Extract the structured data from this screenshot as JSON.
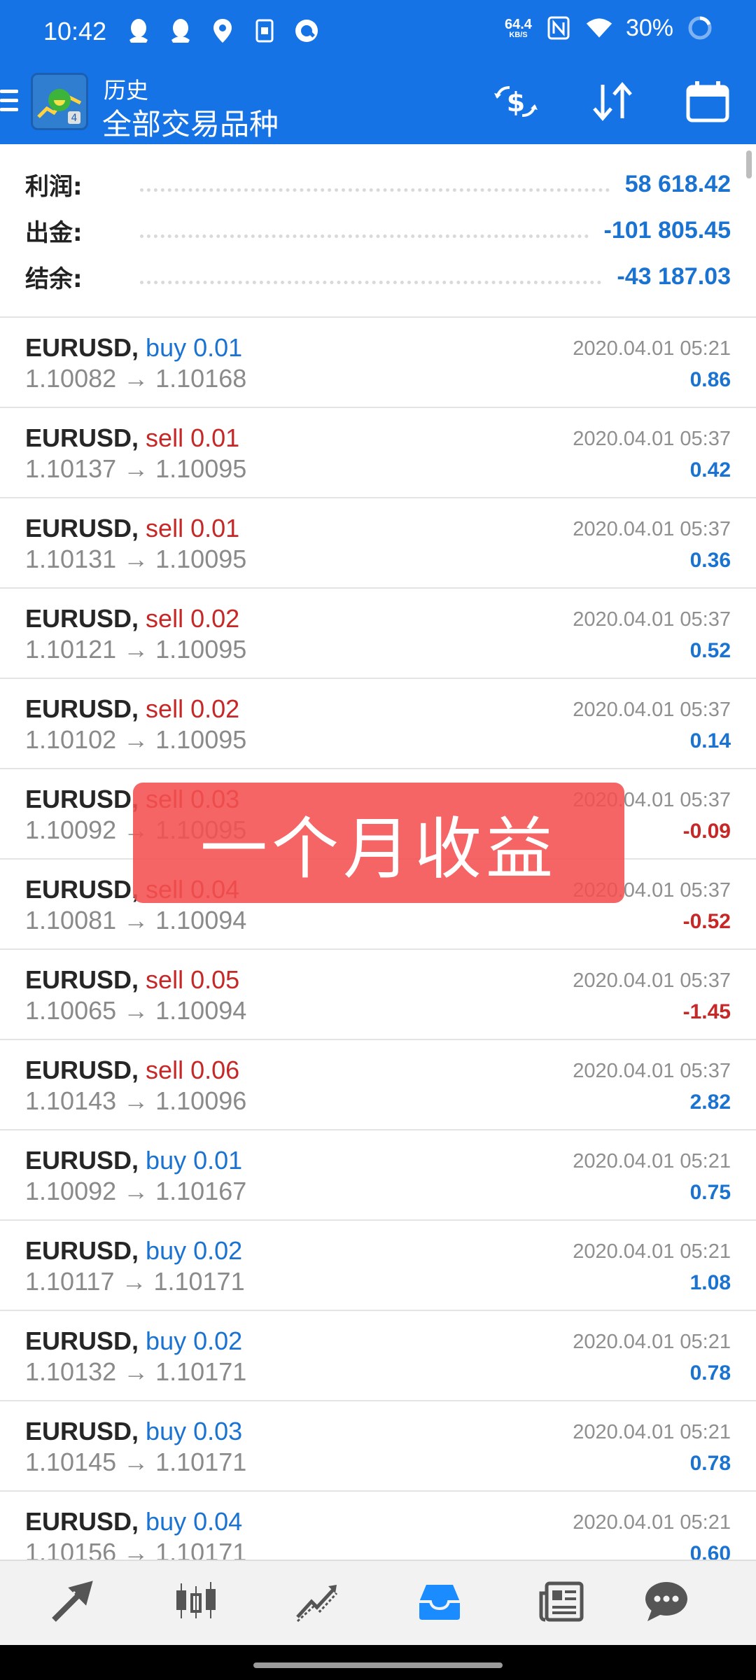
{
  "status_bar": {
    "time": "10:42",
    "speed_value": "64.4",
    "speed_unit": "KB/S",
    "battery": "30%",
    "icons": [
      "qq-icon",
      "qq-icon",
      "location-icon",
      "sim-icon",
      "app-icon",
      "nfc-icon",
      "wifi-icon",
      "battery-ring-icon"
    ]
  },
  "header": {
    "subtitle": "历史",
    "title": "全部交易品种",
    "buttons": [
      "currency-exchange-icon",
      "sort-icon",
      "calendar-icon"
    ]
  },
  "summary": [
    {
      "label": "利润:",
      "value": "58 618.42"
    },
    {
      "label": "出金:",
      "value": "-101 805.45"
    },
    {
      "label": "结余:",
      "value": "-43 187.03"
    }
  ],
  "trades": [
    {
      "symbol": "EURUSD,",
      "side": "buy",
      "lot": "buy 0.01",
      "prices": "1.10082 → 1.10168",
      "time": "2020.04.01 05:21",
      "profit": "0.86"
    },
    {
      "symbol": "EURUSD,",
      "side": "sell",
      "lot": "sell 0.01",
      "prices": "1.10137 → 1.10095",
      "time": "2020.04.01 05:37",
      "profit": "0.42"
    },
    {
      "symbol": "EURUSD,",
      "side": "sell",
      "lot": "sell 0.01",
      "prices": "1.10131 → 1.10095",
      "time": "2020.04.01 05:37",
      "profit": "0.36"
    },
    {
      "symbol": "EURUSD,",
      "side": "sell",
      "lot": "sell 0.02",
      "prices": "1.10121 → 1.10095",
      "time": "2020.04.01 05:37",
      "profit": "0.52"
    },
    {
      "symbol": "EURUSD,",
      "side": "sell",
      "lot": "sell 0.02",
      "prices": "1.10102 → 1.10095",
      "time": "2020.04.01 05:37",
      "profit": "0.14"
    },
    {
      "symbol": "EURUSD,",
      "side": "sell",
      "lot": "sell 0.03",
      "prices": "1.10092 → 1.10095",
      "time": "2020.04.01 05:37",
      "profit": "-0.09"
    },
    {
      "symbol": "EURUSD,",
      "side": "sell",
      "lot": "sell 0.04",
      "prices": "1.10081 → 1.10094",
      "time": "2020.04.01 05:37",
      "profit": "-0.52"
    },
    {
      "symbol": "EURUSD,",
      "side": "sell",
      "lot": "sell 0.05",
      "prices": "1.10065 → 1.10094",
      "time": "2020.04.01 05:37",
      "profit": "-1.45"
    },
    {
      "symbol": "EURUSD,",
      "side": "sell",
      "lot": "sell 0.06",
      "prices": "1.10143 → 1.10096",
      "time": "2020.04.01 05:37",
      "profit": "2.82"
    },
    {
      "symbol": "EURUSD,",
      "side": "buy",
      "lot": "buy 0.01",
      "prices": "1.10092 → 1.10167",
      "time": "2020.04.01 05:21",
      "profit": "0.75"
    },
    {
      "symbol": "EURUSD,",
      "side": "buy",
      "lot": "buy 0.02",
      "prices": "1.10117 → 1.10171",
      "time": "2020.04.01 05:21",
      "profit": "1.08"
    },
    {
      "symbol": "EURUSD,",
      "side": "buy",
      "lot": "buy 0.02",
      "prices": "1.10132 → 1.10171",
      "time": "2020.04.01 05:21",
      "profit": "0.78"
    },
    {
      "symbol": "EURUSD,",
      "side": "buy",
      "lot": "buy 0.03",
      "prices": "1.10145 → 1.10171",
      "time": "2020.04.01 05:21",
      "profit": "0.78"
    },
    {
      "symbol": "EURUSD,",
      "side": "buy",
      "lot": "buy 0.04",
      "prices": "1.10156 → 1.10171",
      "time": "2020.04.01 05:21",
      "profit": "0.60"
    }
  ],
  "overlay_banner": "一个月收益",
  "bottom_nav": [
    "trade-icon",
    "quotes-icon",
    "chart-icon",
    "history-icon",
    "news-icon",
    "chat-icon"
  ],
  "colors": {
    "header_bg": "#1673e6",
    "buy": "#1a73d1",
    "sell": "#c62828",
    "nav_active": "#1a8cff",
    "banner": "#f45050"
  }
}
